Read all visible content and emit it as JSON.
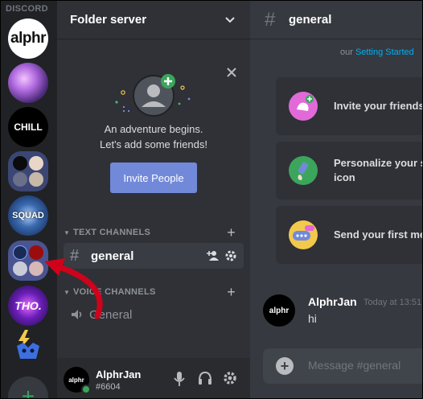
{
  "app": {
    "title": "DISCORD"
  },
  "servers": [
    {
      "name": "alphr",
      "label": "alphr"
    },
    {
      "name": "anime"
    },
    {
      "name": "chill",
      "label": "CHILL"
    },
    {
      "name": "folder-1"
    },
    {
      "name": "squad",
      "label": "SQUAD"
    },
    {
      "name": "folder-2"
    },
    {
      "name": "tho",
      "label": "THO."
    },
    {
      "name": "bolt"
    }
  ],
  "sidebar": {
    "server_name": "Folder server",
    "invite": {
      "line1": "An adventure begins.",
      "line2": "Let's add some friends!",
      "button": "Invite People"
    },
    "text_category": "TEXT CHANNELS",
    "voice_category": "VOICE CHANNELS",
    "text_channels": [
      {
        "name": "general"
      }
    ],
    "voice_channels": [
      {
        "name": "General"
      }
    ]
  },
  "user": {
    "name": "AlphrJan",
    "tag": "#6604",
    "avatar_label": "alphr"
  },
  "main": {
    "channel": "general",
    "top_fragment": "our",
    "top_link": "Setting Started",
    "cards": [
      {
        "label": "Invite your friends"
      },
      {
        "label_line1": "Personalize your se",
        "label_line2": "icon"
      },
      {
        "label": "Send your first mes"
      }
    ],
    "message": {
      "author": "AlphrJan",
      "time": "Today at 13:51",
      "text": "hi",
      "avatar_label": "alphr"
    },
    "composer_placeholder": "Message #general"
  },
  "colors": {
    "accent": "#7289da",
    "online": "#3ba55c",
    "annotation": "#d0021b"
  }
}
